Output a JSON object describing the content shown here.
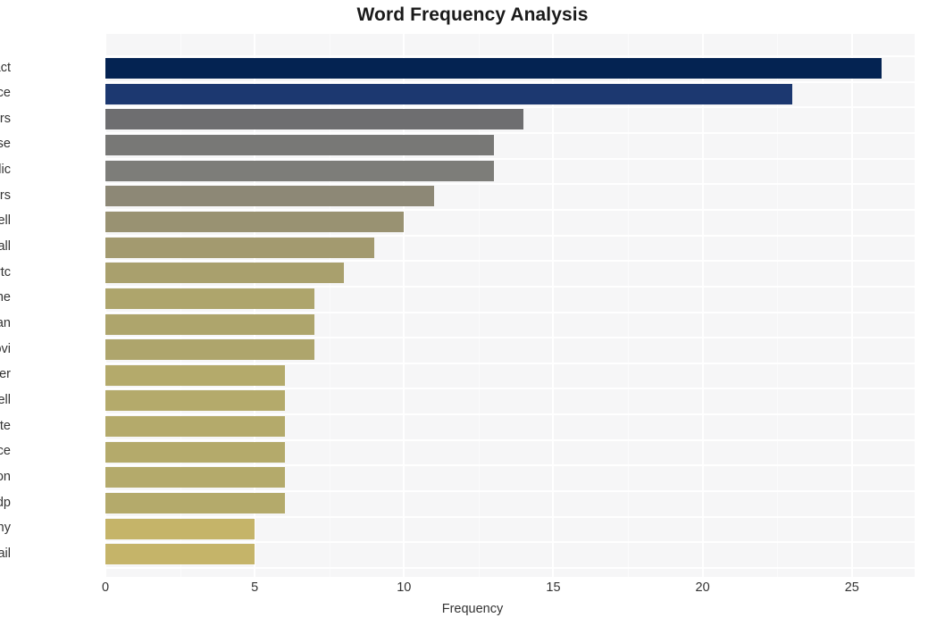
{
  "chart_data": {
    "type": "bar",
    "orientation": "horizontal",
    "title": "Word Frequency Analysis",
    "xlabel": "Frequency",
    "ylabel": "",
    "categories": [
      "contract",
      "price",
      "rogers",
      "increase",
      "public",
      "customers",
      "bell",
      "call",
      "crtc",
      "phone",
      "norman",
      "pavlovi",
      "customer",
      "tell",
      "investigate",
      "service",
      "spokesperson",
      "ndp",
      "company",
      "email"
    ],
    "values": [
      26,
      23,
      14,
      13,
      13,
      11,
      10,
      9,
      8,
      7,
      7,
      7,
      6,
      6,
      6,
      6,
      6,
      6,
      5,
      5
    ],
    "bar_colors": [
      "#042352",
      "#1c3870",
      "#6e6e70",
      "#787876",
      "#7d7d79",
      "#8d8876",
      "#999272",
      "#a39a6f",
      "#a9a06d",
      "#aea56c",
      "#aea56c",
      "#aea56c",
      "#b4aa6b",
      "#b4aa6b",
      "#b4aa6b",
      "#b4aa6b",
      "#b4aa6b",
      "#b4aa6b",
      "#c5b469",
      "#c5b469"
    ],
    "xlim": [
      0,
      27.1
    ],
    "xticks": [
      0,
      5,
      10,
      15,
      20,
      25
    ],
    "xtick_labels": [
      "0",
      "5",
      "10",
      "15",
      "20",
      "25"
    ],
    "grid": true,
    "grid_color": "#ffffff",
    "plot_background": "#f6f6f7",
    "figure_background": "#ffffff",
    "legend": null
  }
}
